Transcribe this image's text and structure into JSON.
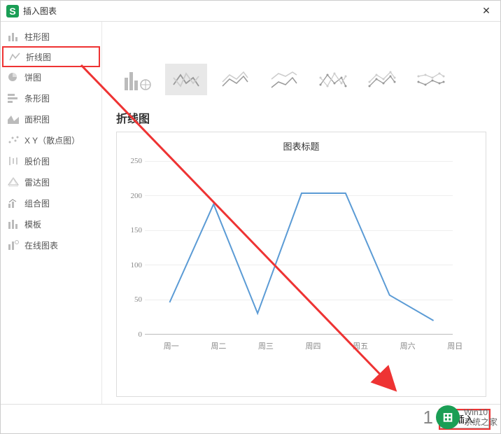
{
  "window": {
    "title": "插入图表"
  },
  "sidebar": {
    "items": [
      {
        "label": "柱形图",
        "name": "sidebar-item-column"
      },
      {
        "label": "折线图",
        "name": "sidebar-item-line",
        "selected": true
      },
      {
        "label": "饼图",
        "name": "sidebar-item-pie"
      },
      {
        "label": "条形图",
        "name": "sidebar-item-bar"
      },
      {
        "label": "面积图",
        "name": "sidebar-item-area"
      },
      {
        "label": "X Y（散点图）",
        "name": "sidebar-item-scatter"
      },
      {
        "label": "股价图",
        "name": "sidebar-item-stock"
      },
      {
        "label": "雷达图",
        "name": "sidebar-item-radar"
      },
      {
        "label": "组合图",
        "name": "sidebar-item-combo"
      },
      {
        "label": "模板",
        "name": "sidebar-item-template"
      },
      {
        "label": "在线图表",
        "name": "sidebar-item-online"
      }
    ]
  },
  "subtypes": {
    "items": [
      {
        "name": "subtype-column-glyph"
      },
      {
        "name": "subtype-line-basic",
        "selected": true
      },
      {
        "name": "subtype-line-stacked"
      },
      {
        "name": "subtype-line-100stacked"
      },
      {
        "name": "subtype-line-markers"
      },
      {
        "name": "subtype-line-stacked-markers"
      },
      {
        "name": "subtype-line-100stacked-markers"
      }
    ]
  },
  "section_title": "折线图",
  "chart_data": {
    "type": "line",
    "title": "图表标题",
    "categories": [
      "周一",
      "周二",
      "周三",
      "周四",
      "周五",
      "周六",
      "周日"
    ],
    "values": [
      50,
      185,
      35,
      200,
      200,
      60,
      25
    ],
    "ylim": [
      0,
      250
    ],
    "yticks": [
      0,
      50,
      100,
      150,
      200,
      250
    ],
    "xlabel": "",
    "ylabel": ""
  },
  "footer": {
    "insert": "插入"
  },
  "watermark": {
    "line1": "Win10",
    "line2": "系统之家"
  }
}
